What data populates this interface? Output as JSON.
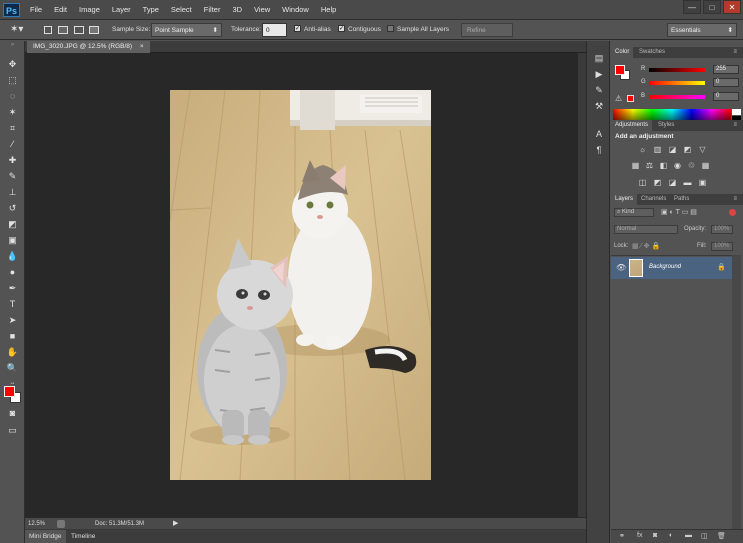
{
  "app": {
    "logo": "Ps",
    "window_controls": [
      "—",
      "□",
      "✕"
    ]
  },
  "menu": [
    "File",
    "Edit",
    "Image",
    "Layer",
    "Type",
    "Select",
    "Filter",
    "3D",
    "View",
    "Window",
    "Help"
  ],
  "options_bar": {
    "tool_icon": "magic-wand-icon",
    "sample_size_label": "Sample Size:",
    "sample_size_value": "Point Sample",
    "tolerance_label": "Tolerance:",
    "tolerance_value": "0",
    "anti_alias_label": "Anti-alias",
    "anti_alias_checked": true,
    "contiguous_label": "Contiguous",
    "contiguous_checked": true,
    "sample_all_layers_label": "Sample All Layers",
    "sample_all_layers_checked": false,
    "refine_edge_label": "Refine Edge...",
    "workspace_value": "Essentials"
  },
  "document": {
    "tab_title": "IMG_3020.JPG @ 12.5% (RGB/8)",
    "close_glyph": "×"
  },
  "status_bar": {
    "zoom": "12.5%",
    "doc_info": "Doc: 51.3M/51.3M"
  },
  "bottom_tabs": [
    "Mini Bridge",
    "Timeline"
  ],
  "color_panel": {
    "tabs": [
      "Color",
      "Swatches"
    ],
    "channels": [
      {
        "label": "R",
        "value": "255"
      },
      {
        "label": "G",
        "value": "0"
      },
      {
        "label": "B",
        "value": "0"
      }
    ],
    "foreground": "#ff0000",
    "background": "#ffffff"
  },
  "adjustments_panel": {
    "tabs": [
      "Adjustments",
      "Styles"
    ],
    "heading": "Add an adjustment"
  },
  "layers_panel": {
    "tabs": [
      "Layers",
      "Channels",
      "Paths"
    ],
    "filter_kind": "Kind",
    "blend_mode": "Normal",
    "opacity_label": "Opacity:",
    "opacity_value": "100%",
    "lock_label": "Lock:",
    "fill_label": "Fill:",
    "fill_value": "100%",
    "layers": [
      {
        "name": "Background",
        "visible": true,
        "locked": true
      }
    ]
  },
  "colors": {
    "accent_selected_layer": "#4a6380",
    "panel_bg": "#535353",
    "canvas_bg": "#282828"
  }
}
